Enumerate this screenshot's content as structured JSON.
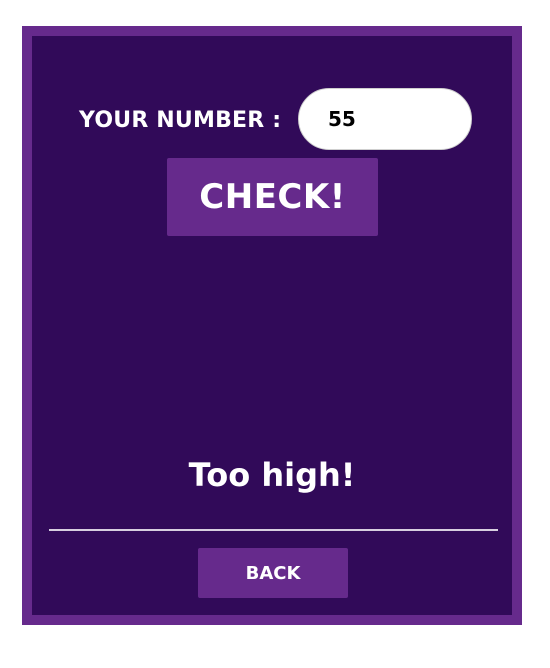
{
  "form": {
    "number_label": "YOUR NUMBER :",
    "number_value": "55",
    "check_label": "CHECK!"
  },
  "result": {
    "message": "Too high!"
  },
  "footer": {
    "back_label": "BACK"
  },
  "colors": {
    "frame": "#662a8c",
    "panel": "#310a59",
    "button": "#662a8c",
    "text": "#ffffff",
    "input_background": "#ffffff"
  }
}
